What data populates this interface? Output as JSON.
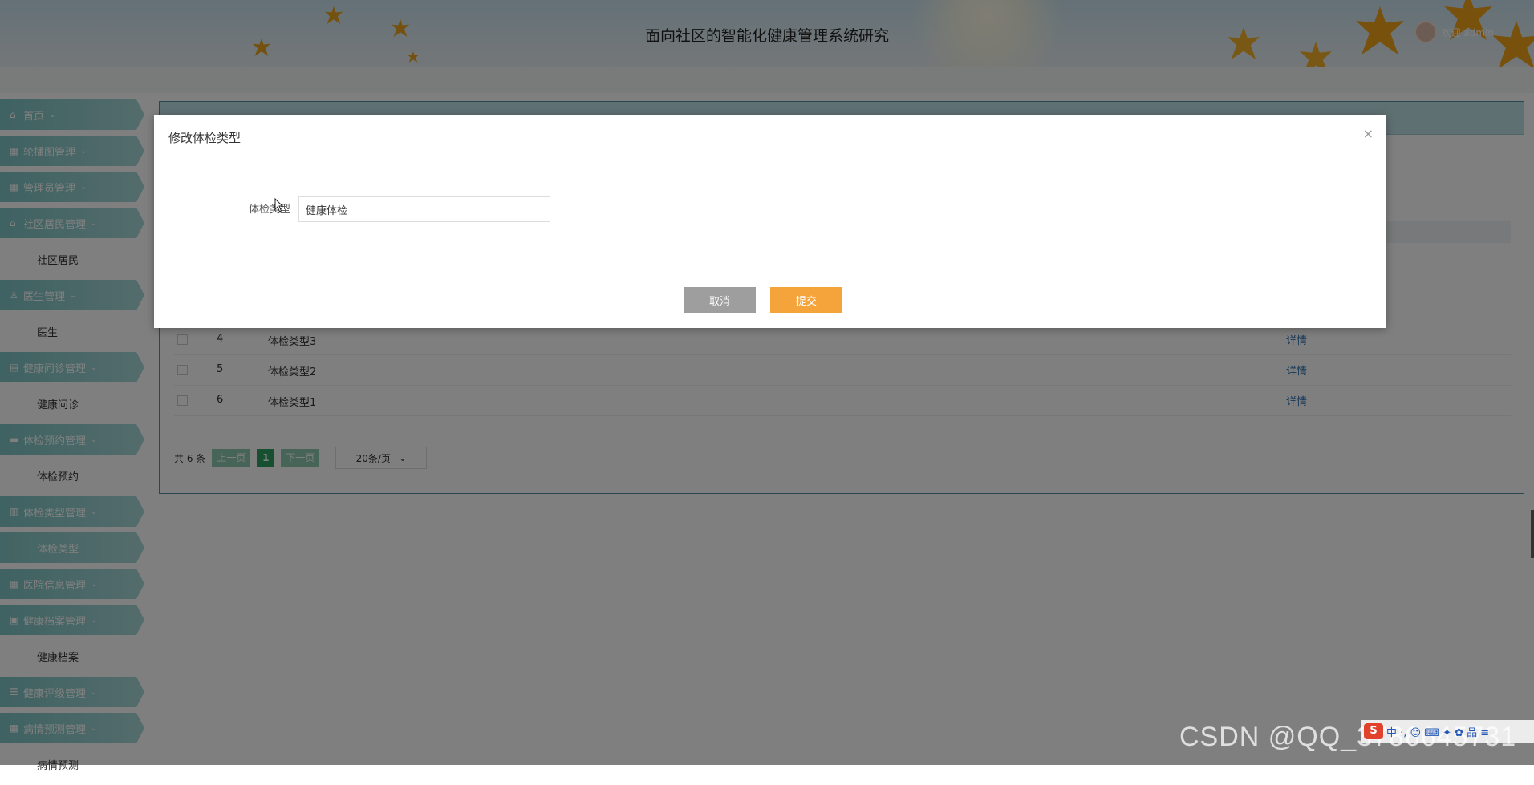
{
  "header": {
    "title": "面向社区的智能化健康管理系统研究",
    "welcome": "欢迎 admin"
  },
  "sidebar": {
    "items": [
      {
        "type": "group",
        "label": "首页",
        "icon": "home-icon"
      },
      {
        "type": "group",
        "label": "轮播图管理",
        "icon": "grid-icon"
      },
      {
        "type": "group",
        "label": "管理员管理",
        "icon": "grid-icon"
      },
      {
        "type": "group",
        "label": "社区居民管理",
        "icon": "community-icon"
      },
      {
        "type": "sub",
        "label": "社区居民"
      },
      {
        "type": "group",
        "label": "医生管理",
        "icon": "user-icon"
      },
      {
        "type": "sub",
        "label": "医生"
      },
      {
        "type": "group",
        "label": "健康问诊管理",
        "icon": "clipboard-icon"
      },
      {
        "type": "sub",
        "label": "健康问诊"
      },
      {
        "type": "group",
        "label": "体检预约管理",
        "icon": "car-icon"
      },
      {
        "type": "sub",
        "label": "体检预约"
      },
      {
        "type": "group",
        "label": "体检类型管理",
        "icon": "book-icon"
      },
      {
        "type": "sub",
        "label": "体检类型",
        "active": true
      },
      {
        "type": "group",
        "label": "医院信息管理",
        "icon": "grid-icon"
      },
      {
        "type": "group",
        "label": "健康档案管理",
        "icon": "file-icon"
      },
      {
        "type": "sub",
        "label": "健康档案"
      },
      {
        "type": "group",
        "label": "健康评级管理",
        "icon": "list-icon"
      },
      {
        "type": "group",
        "label": "病情预测管理",
        "icon": "chart-icon"
      },
      {
        "type": "sub",
        "label": "病情预测"
      }
    ]
  },
  "table": {
    "rows": [
      {
        "index": "4",
        "name": "体检类型3",
        "action": "详情"
      },
      {
        "index": "5",
        "name": "体检类型2",
        "action": "详情"
      },
      {
        "index": "6",
        "name": "体检类型1",
        "action": "详情"
      }
    ]
  },
  "pager": {
    "total": "共 6 条",
    "prev": "上一页",
    "current": "1",
    "next": "下一页",
    "page_size": "20条/页"
  },
  "modal": {
    "title": "修改体检类型",
    "close": "×",
    "field_label": "体检类型",
    "field_value": "健康体检",
    "cancel": "取消",
    "submit": "提交"
  },
  "watermark": "CSDN @QQ_3786645731",
  "ime": {
    "logo": "S",
    "glyphs": "中 ·, ☺ ⌨ ✦ ✿ 品 ≡"
  },
  "colors": {
    "accent": "#f4a43a",
    "sidebar": "#7ec4c4",
    "pager_active": "#2e9e62",
    "link": "#2a6fb0"
  }
}
